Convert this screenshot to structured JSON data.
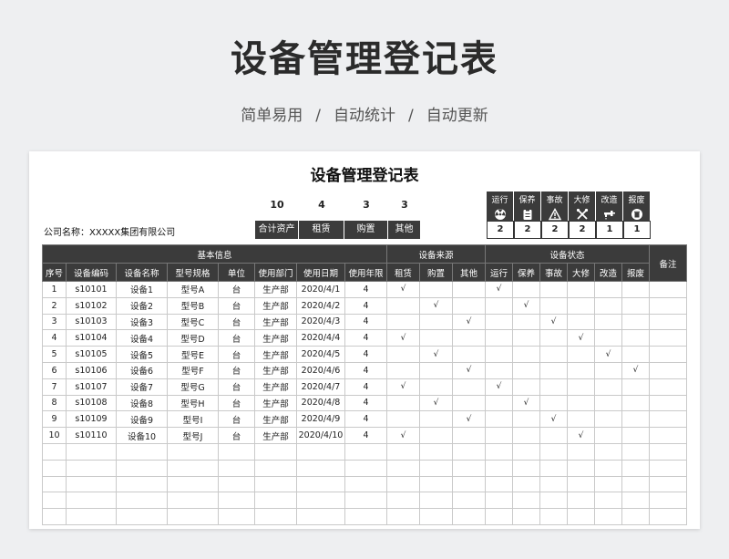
{
  "hero": {
    "title": "设备管理登记表",
    "subtitle": [
      "简单易用",
      "/",
      "自动统计",
      "/",
      "自动更新"
    ]
  },
  "sheet": {
    "title": "设备管理登记表",
    "company_label": "公司名称：XXXXX集团有限公司",
    "source_summary": [
      {
        "label": "合计资产",
        "value": "10"
      },
      {
        "label": "租赁",
        "value": "4"
      },
      {
        "label": "购置",
        "value": "3"
      },
      {
        "label": "其他",
        "value": "3"
      }
    ],
    "status_summary": [
      {
        "label": "运行",
        "icon": "radiation-icon",
        "value": "2"
      },
      {
        "label": "保养",
        "icon": "clipboard-icon",
        "value": "2"
      },
      {
        "label": "事故",
        "icon": "warning-icon",
        "value": "2"
      },
      {
        "label": "大修",
        "icon": "tools-icon",
        "value": "2"
      },
      {
        "label": "改造",
        "icon": "faucet-icon",
        "value": "1"
      },
      {
        "label": "报废",
        "icon": "trash-icon",
        "value": "1"
      }
    ],
    "group_headers": {
      "basic": "基本信息",
      "source": "设备来源",
      "status": "设备状态",
      "remark": "备注"
    },
    "columns": [
      "序号",
      "设备编码",
      "设备名称",
      "型号规格",
      "单位",
      "使用部门",
      "使用日期",
      "使用年限",
      "租赁",
      "购置",
      "其他",
      "运行",
      "保养",
      "事故",
      "大修",
      "改造",
      "报废"
    ],
    "check_mark": "√",
    "rows": [
      {
        "no": "1",
        "code": "s10101",
        "name": "设备1",
        "model": "型号A",
        "unit": "台",
        "dept": "生产部",
        "date": "2020/4/1",
        "years": "4",
        "source": 0,
        "status": 0
      },
      {
        "no": "2",
        "code": "s10102",
        "name": "设备2",
        "model": "型号B",
        "unit": "台",
        "dept": "生产部",
        "date": "2020/4/2",
        "years": "4",
        "source": 1,
        "status": 1
      },
      {
        "no": "3",
        "code": "s10103",
        "name": "设备3",
        "model": "型号C",
        "unit": "台",
        "dept": "生产部",
        "date": "2020/4/3",
        "years": "4",
        "source": 2,
        "status": 2
      },
      {
        "no": "4",
        "code": "s10104",
        "name": "设备4",
        "model": "型号D",
        "unit": "台",
        "dept": "生产部",
        "date": "2020/4/4",
        "years": "4",
        "source": 0,
        "status": 3
      },
      {
        "no": "5",
        "code": "s10105",
        "name": "设备5",
        "model": "型号E",
        "unit": "台",
        "dept": "生产部",
        "date": "2020/4/5",
        "years": "4",
        "source": 1,
        "status": 4
      },
      {
        "no": "6",
        "code": "s10106",
        "name": "设备6",
        "model": "型号F",
        "unit": "台",
        "dept": "生产部",
        "date": "2020/4/6",
        "years": "4",
        "source": 2,
        "status": 5
      },
      {
        "no": "7",
        "code": "s10107",
        "name": "设备7",
        "model": "型号G",
        "unit": "台",
        "dept": "生产部",
        "date": "2020/4/7",
        "years": "4",
        "source": 0,
        "status": 0
      },
      {
        "no": "8",
        "code": "s10108",
        "name": "设备8",
        "model": "型号H",
        "unit": "台",
        "dept": "生产部",
        "date": "2020/4/8",
        "years": "4",
        "source": 1,
        "status": 1
      },
      {
        "no": "9",
        "code": "s10109",
        "name": "设备9",
        "model": "型号I",
        "unit": "台",
        "dept": "生产部",
        "date": "2020/4/9",
        "years": "4",
        "source": 2,
        "status": 2
      },
      {
        "no": "10",
        "code": "s10110",
        "name": "设备10",
        "model": "型号J",
        "unit": "台",
        "dept": "生产部",
        "date": "2020/4/10",
        "years": "4",
        "source": 0,
        "status": 3
      }
    ],
    "empty_rows": 5
  }
}
